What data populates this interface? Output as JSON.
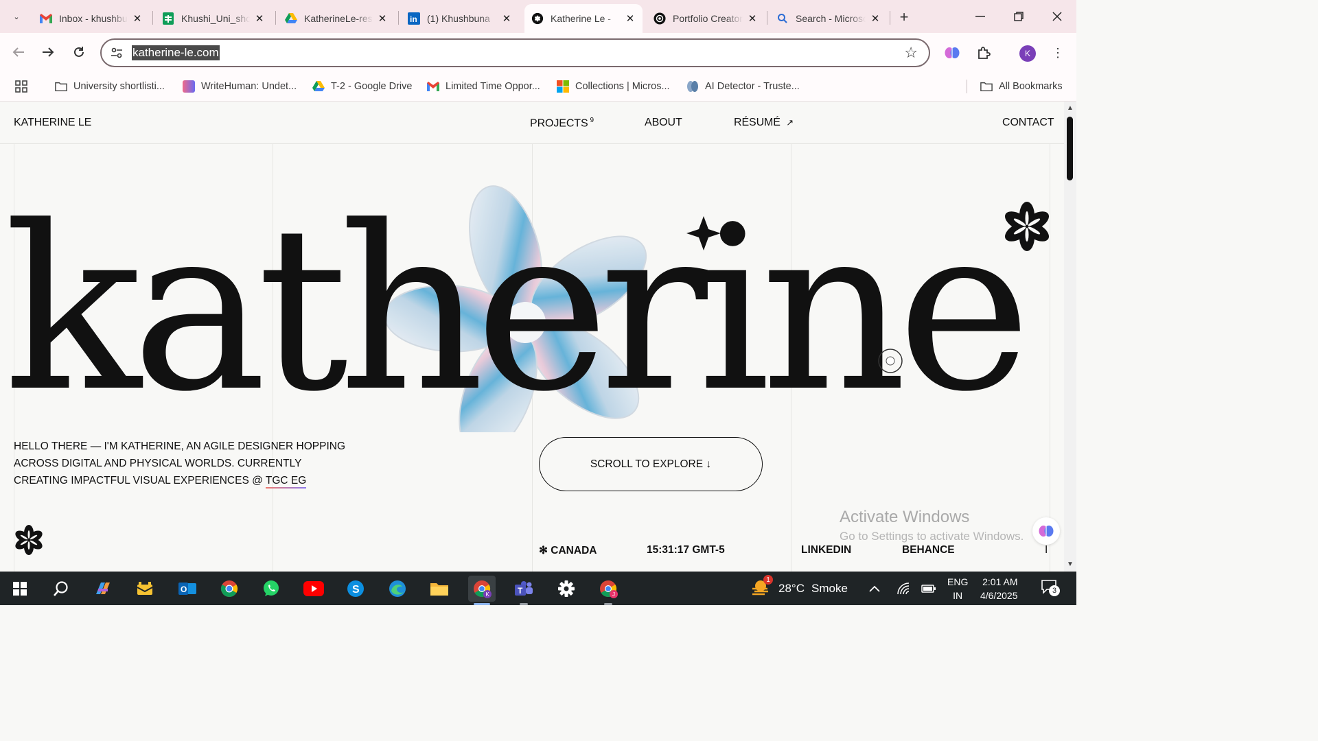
{
  "browser": {
    "tabs": [
      {
        "title": "Inbox - khushbuna",
        "icon": "gmail-icon"
      },
      {
        "title": "Khushi_Uni_shortlist",
        "icon": "sheets-icon"
      },
      {
        "title": "KatherineLe-resume",
        "icon": "drive-icon"
      },
      {
        "title": "(1) Khushbuna",
        "icon": "linkedin-icon"
      },
      {
        "title": "Katherine Le -",
        "icon": "site-flower-icon",
        "active": true
      },
      {
        "title": "Portfolio Creator",
        "icon": "chatgpt-icon"
      },
      {
        "title": "Search - Microsoft",
        "icon": "search-icon"
      }
    ],
    "url": "katherine-le.com",
    "profile_initial": "K",
    "bookmarks": [
      {
        "label": "University shortlisti...",
        "icon": "folder-icon"
      },
      {
        "label": "WriteHuman: Undet...",
        "icon": "writehuman-icon"
      },
      {
        "label": "T-2 - Google Drive",
        "icon": "drive-icon"
      },
      {
        "label": "Limited Time Oppor...",
        "icon": "gmail-icon"
      },
      {
        "label": "Collections | Micros...",
        "icon": "microsoft-icon"
      },
      {
        "label": "AI Detector - Truste...",
        "icon": "ai-detector-icon"
      }
    ],
    "all_bookmarks": "All Bookmarks"
  },
  "site": {
    "brand": "KATHERINE LE",
    "nav": {
      "projects": "PROJECTS",
      "projects_count": "9",
      "about": "ABOUT",
      "resume": "RÉSUMÉ",
      "resume_arrow": "↗",
      "contact": "CONTACT"
    },
    "hero_word": "katherine",
    "intro_before": "HELLO THERE — I'M KATHERINE, AN AGILE DESIGNER HOPPING ACROSS DIGITAL AND PHYSICAL WORLDS. CURRENTLY CREATING IMPACTFUL VISUAL EXPERIENCES @ ",
    "intro_link": "TGC EG",
    "scroll_cta": "SCROLL TO EXPLORE ↓",
    "footer": {
      "location": "✻ CANADA",
      "time": "15:31:17 GMT-5",
      "linkedin": "LINKEDIN",
      "behance": "BEHANCE",
      "more": "I"
    },
    "watermark_line1": "Activate Windows",
    "watermark_line2": "Go to Settings to activate Windows."
  },
  "taskbar": {
    "weather_temp": "28°C",
    "weather_desc": "Smoke",
    "weather_badge": "1",
    "lang_line1": "ENG",
    "lang_line2": "IN",
    "time": "2:01 AM",
    "date": "4/6/2025",
    "notif_count": "3",
    "apps": [
      "start",
      "search",
      "copilot",
      "mail-app",
      "outlook",
      "chrome",
      "whatsapp",
      "youtube",
      "skype",
      "edge",
      "file-explorer",
      "chrome-profile-k",
      "teams",
      "settings",
      "chrome-profile-j"
    ]
  },
  "colors": {
    "tabstrip": "#f6e6ea",
    "page_bg": "#f8f8f6",
    "ink": "#111111",
    "taskbar": "#1f2426"
  }
}
